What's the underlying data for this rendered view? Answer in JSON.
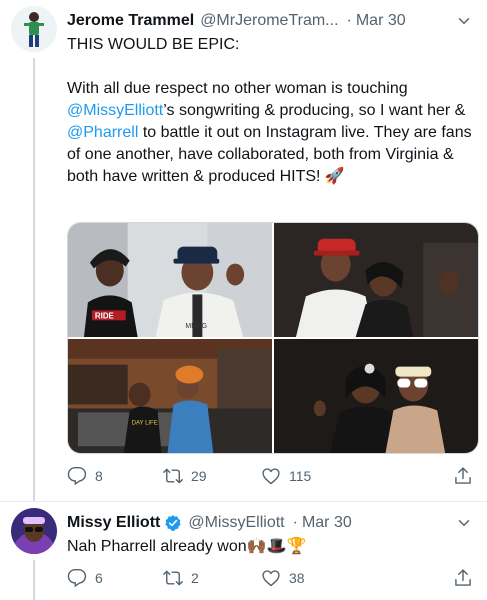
{
  "tweets": [
    {
      "name": "Jerome Trammel",
      "handle": "@MrJeromeTram...",
      "separator": "·",
      "time": "Mar 30",
      "line1": "THIS WOULD BE EPIC:",
      "p2_pre": "With all due respect no other woman is touching ",
      "mention1": "@MissyElliott",
      "p2_mid": "’s songwriting & producing, so I want her & ",
      "mention2": "@Pharrell",
      "p2_post": " to battle it out on Instagram live. They are fans of one another, have collaborated, both from Virginia & both have written & produced HITS! 🚀",
      "media": [
        {
          "shirt_text_left": "RIDE",
          "shirt_text_right": "MMAG"
        },
        {},
        {
          "shirt_text": "DAY LIFE"
        },
        {}
      ],
      "replies": "8",
      "retweets": "29",
      "likes": "115"
    },
    {
      "name": "Missy Elliott",
      "handle": "@MissyElliott",
      "separator": "·",
      "time": "Mar 30",
      "text": "Nah Pharrell already won🙌🏾🎩🏆",
      "replies": "6",
      "retweets": "2",
      "likes": "38"
    }
  ],
  "icons": {
    "reply": "reply-icon",
    "retweet": "retweet-icon",
    "like": "like-icon",
    "share": "share-icon",
    "more": "chevron-down-icon",
    "verified": "verified-badge-icon"
  },
  "colors": {
    "accent": "#1d9bf0",
    "muted": "#536471",
    "text": "#0f1419"
  }
}
